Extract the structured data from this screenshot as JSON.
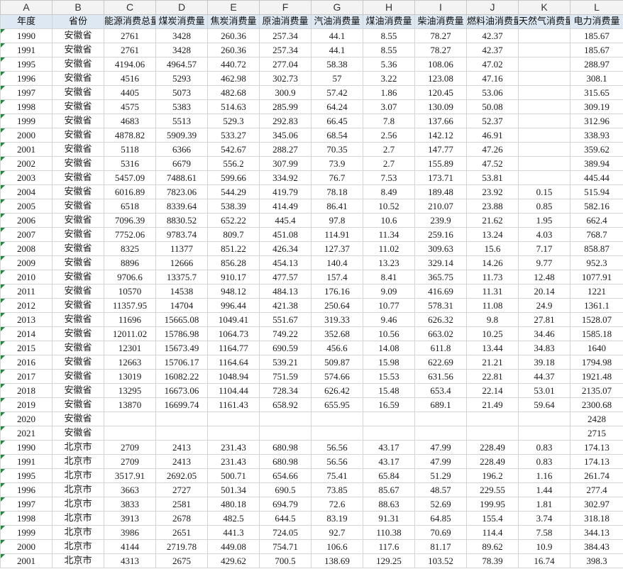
{
  "columns": [
    "A",
    "B",
    "C",
    "D",
    "E",
    "F",
    "G",
    "H",
    "I",
    "J",
    "K",
    "L"
  ],
  "headers": [
    "年度",
    "省份",
    "能源消费总量",
    "煤炭消费量",
    "焦炭消费量",
    "原油消费量",
    "汽油消费量",
    "煤油消费量",
    "柴油消费量",
    "燃料油消费量",
    "天然气消费量",
    "电力消费量"
  ],
  "rows": [
    [
      "1990",
      "安徽省",
      "2761",
      "3428",
      "260.36",
      "257.34",
      "44.1",
      "8.55",
      "78.27",
      "42.37",
      "",
      "185.67"
    ],
    [
      "1991",
      "安徽省",
      "2761",
      "3428",
      "260.36",
      "257.34",
      "44.1",
      "8.55",
      "78.27",
      "42.37",
      "",
      "185.67"
    ],
    [
      "1995",
      "安徽省",
      "4194.06",
      "4964.57",
      "440.72",
      "277.04",
      "58.38",
      "5.36",
      "108.06",
      "47.02",
      "",
      "288.97"
    ],
    [
      "1996",
      "安徽省",
      "4516",
      "5293",
      "462.98",
      "302.73",
      "57",
      "3.22",
      "123.08",
      "47.16",
      "",
      "308.1"
    ],
    [
      "1997",
      "安徽省",
      "4405",
      "5073",
      "482.68",
      "300.9",
      "57.42",
      "1.86",
      "120.45",
      "53.06",
      "",
      "315.65"
    ],
    [
      "1998",
      "安徽省",
      "4575",
      "5383",
      "514.63",
      "285.99",
      "64.24",
      "3.07",
      "130.09",
      "50.08",
      "",
      "309.19"
    ],
    [
      "1999",
      "安徽省",
      "4683",
      "5513",
      "529.3",
      "292.83",
      "66.45",
      "7.8",
      "137.66",
      "52.37",
      "",
      "312.96"
    ],
    [
      "2000",
      "安徽省",
      "4878.82",
      "5909.39",
      "533.27",
      "345.06",
      "68.54",
      "2.56",
      "142.12",
      "46.91",
      "",
      "338.93"
    ],
    [
      "2001",
      "安徽省",
      "5118",
      "6366",
      "542.67",
      "288.27",
      "70.35",
      "2.7",
      "147.77",
      "47.26",
      "",
      "359.62"
    ],
    [
      "2002",
      "安徽省",
      "5316",
      "6679",
      "556.2",
      "307.99",
      "73.9",
      "2.7",
      "155.89",
      "47.52",
      "",
      "389.94"
    ],
    [
      "2003",
      "安徽省",
      "5457.09",
      "7488.61",
      "599.66",
      "334.92",
      "76.7",
      "7.53",
      "173.71",
      "53.81",
      "",
      "445.44"
    ],
    [
      "2004",
      "安徽省",
      "6016.89",
      "7823.06",
      "544.29",
      "419.79",
      "78.18",
      "8.49",
      "189.48",
      "23.92",
      "0.15",
      "515.94"
    ],
    [
      "2005",
      "安徽省",
      "6518",
      "8339.64",
      "538.39",
      "414.49",
      "86.41",
      "10.52",
      "210.07",
      "23.88",
      "0.85",
      "582.16"
    ],
    [
      "2006",
      "安徽省",
      "7096.39",
      "8830.52",
      "652.22",
      "445.4",
      "97.8",
      "10.6",
      "239.9",
      "21.62",
      "1.95",
      "662.4"
    ],
    [
      "2007",
      "安徽省",
      "7752.06",
      "9783.74",
      "809.7",
      "451.08",
      "114.91",
      "11.34",
      "259.16",
      "13.24",
      "4.03",
      "768.7"
    ],
    [
      "2008",
      "安徽省",
      "8325",
      "11377",
      "851.22",
      "426.34",
      "127.37",
      "11.02",
      "309.63",
      "15.6",
      "7.17",
      "858.87"
    ],
    [
      "2009",
      "安徽省",
      "8896",
      "12666",
      "856.28",
      "454.13",
      "140.4",
      "13.23",
      "329.14",
      "14.26",
      "9.77",
      "952.3"
    ],
    [
      "2010",
      "安徽省",
      "9706.6",
      "13375.7",
      "910.17",
      "477.57",
      "157.4",
      "8.41",
      "365.75",
      "11.73",
      "12.48",
      "1077.91"
    ],
    [
      "2011",
      "安徽省",
      "10570",
      "14538",
      "948.12",
      "484.13",
      "176.16",
      "9.09",
      "416.69",
      "11.31",
      "20.14",
      "1221"
    ],
    [
      "2012",
      "安徽省",
      "11357.95",
      "14704",
      "996.44",
      "421.38",
      "250.64",
      "10.77",
      "578.31",
      "11.08",
      "24.9",
      "1361.1"
    ],
    [
      "2013",
      "安徽省",
      "11696",
      "15665.08",
      "1049.41",
      "551.67",
      "319.33",
      "9.46",
      "626.32",
      "9.8",
      "27.81",
      "1528.07"
    ],
    [
      "2014",
      "安徽省",
      "12011.02",
      "15786.98",
      "1064.73",
      "749.22",
      "352.68",
      "10.56",
      "663.02",
      "10.25",
      "34.46",
      "1585.18"
    ],
    [
      "2015",
      "安徽省",
      "12301",
      "15673.49",
      "1164.77",
      "690.59",
      "456.6",
      "14.08",
      "611.8",
      "13.44",
      "34.83",
      "1640"
    ],
    [
      "2016",
      "安徽省",
      "12663",
      "15706.17",
      "1164.64",
      "539.21",
      "509.87",
      "15.98",
      "622.69",
      "21.21",
      "39.18",
      "1794.98"
    ],
    [
      "2017",
      "安徽省",
      "13019",
      "16082.22",
      "1048.94",
      "751.59",
      "574.66",
      "15.53",
      "631.56",
      "22.81",
      "44.37",
      "1921.48"
    ],
    [
      "2018",
      "安徽省",
      "13295",
      "16673.06",
      "1104.44",
      "728.34",
      "626.42",
      "15.48",
      "653.4",
      "22.14",
      "53.01",
      "2135.07"
    ],
    [
      "2019",
      "安徽省",
      "13870",
      "16699.74",
      "1161.43",
      "658.92",
      "655.95",
      "16.59",
      "689.1",
      "21.49",
      "59.64",
      "2300.68"
    ],
    [
      "2020",
      "安徽省",
      "",
      "",
      "",
      "",
      "",
      "",
      "",
      "",
      "",
      "2428"
    ],
    [
      "2021",
      "安徽省",
      "",
      "",
      "",
      "",
      "",
      "",
      "",
      "",
      "",
      "2715"
    ],
    [
      "1990",
      "北京市",
      "2709",
      "2413",
      "231.43",
      "680.98",
      "56.56",
      "43.17",
      "47.99",
      "228.49",
      "0.83",
      "174.13"
    ],
    [
      "1991",
      "北京市",
      "2709",
      "2413",
      "231.43",
      "680.98",
      "56.56",
      "43.17",
      "47.99",
      "228.49",
      "0.83",
      "174.13"
    ],
    [
      "1995",
      "北京市",
      "3517.91",
      "2692.05",
      "500.71",
      "654.66",
      "75.41",
      "65.84",
      "51.29",
      "196.2",
      "1.16",
      "261.74"
    ],
    [
      "1996",
      "北京市",
      "3663",
      "2727",
      "501.34",
      "690.5",
      "73.85",
      "85.67",
      "48.57",
      "229.55",
      "1.44",
      "277.4"
    ],
    [
      "1997",
      "北京市",
      "3833",
      "2581",
      "480.18",
      "694.79",
      "72.6",
      "88.63",
      "52.69",
      "199.95",
      "1.81",
      "302.97"
    ],
    [
      "1998",
      "北京市",
      "3913",
      "2678",
      "482.5",
      "644.5",
      "83.19",
      "91.31",
      "64.85",
      "155.4",
      "3.74",
      "318.18"
    ],
    [
      "1999",
      "北京市",
      "3986",
      "2651",
      "441.3",
      "724.05",
      "92.7",
      "110.38",
      "70.69",
      "114.4",
      "7.58",
      "344.13"
    ],
    [
      "2000",
      "北京市",
      "4144",
      "2719.78",
      "449.08",
      "754.71",
      "106.6",
      "117.6",
      "81.17",
      "89.62",
      "10.9",
      "384.43"
    ],
    [
      "2001",
      "北京市",
      "4313",
      "2675",
      "429.62",
      "700.5",
      "138.69",
      "129.25",
      "103.52",
      "78.39",
      "16.74",
      "398.3"
    ]
  ]
}
